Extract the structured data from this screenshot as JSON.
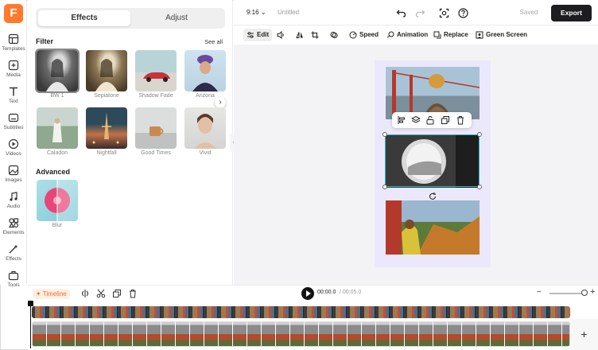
{
  "app": {
    "logo_letter": "F",
    "brand_color": "#ff7a2e"
  },
  "sidebar": {
    "items": [
      {
        "label": "Templates",
        "icon": "templates-icon"
      },
      {
        "label": "Media",
        "icon": "media-icon"
      },
      {
        "label": "Text",
        "icon": "text-icon"
      },
      {
        "label": "Subtitles",
        "icon": "subtitles-icon"
      },
      {
        "label": "Videos",
        "icon": "videos-icon"
      },
      {
        "label": "Images",
        "icon": "images-icon"
      },
      {
        "label": "Audio",
        "icon": "audio-icon"
      },
      {
        "label": "Elements",
        "icon": "elements-icon"
      },
      {
        "label": "Effects",
        "icon": "effects-icon"
      },
      {
        "label": "Tools",
        "icon": "tools-icon"
      }
    ]
  },
  "panel": {
    "tabs": [
      {
        "label": "Effects",
        "active": true
      },
      {
        "label": "Adjust",
        "active": false
      }
    ],
    "filter_title": "Filter",
    "see_all": "See all",
    "filters": [
      "BW 1",
      "Sepiatone",
      "Shadow Fade",
      "Arizona",
      "Caladon",
      "Nightfall",
      "Good Times",
      "Vivid"
    ],
    "advanced_title": "Advanced",
    "advanced": [
      "Blur"
    ]
  },
  "topbar": {
    "ratio": "9:16",
    "title": "Untitled",
    "saved": "Saved",
    "export": "Export"
  },
  "toolbar": {
    "items": [
      "Edit",
      "Speed",
      "Animation",
      "Replace",
      "Green Screen"
    ]
  },
  "timeline": {
    "label": "Timeline",
    "current_time": "00:00.0",
    "total_time": "/ 00:05.0"
  }
}
